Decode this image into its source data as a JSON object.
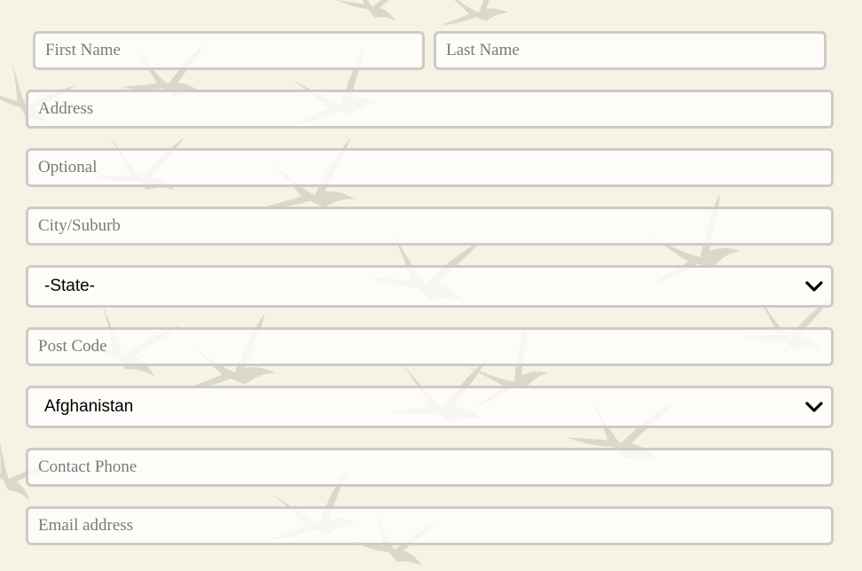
{
  "form": {
    "first_name": {
      "placeholder": "First Name",
      "value": ""
    },
    "last_name": {
      "placeholder": "Last Name",
      "value": ""
    },
    "address": {
      "placeholder": "Address",
      "value": ""
    },
    "address_optional": {
      "placeholder": "Optional",
      "value": ""
    },
    "city": {
      "placeholder": "City/Suburb",
      "value": ""
    },
    "state": {
      "selected": "-State-"
    },
    "post_code": {
      "placeholder": "Post Code",
      "value": ""
    },
    "country": {
      "selected": "Afghanistan"
    },
    "phone": {
      "placeholder": "Contact Phone",
      "value": ""
    },
    "email": {
      "placeholder": "Email address",
      "value": ""
    }
  },
  "icons": {
    "dropdown": "chevron-down-icon",
    "background": "flying-birds-pattern"
  },
  "colors": {
    "background": "#f6f2e4",
    "field_border": "#cdcbc8",
    "field_fill": "#fdfcf9",
    "placeholder_text": "#7a7a7a",
    "select_text": "#000000"
  }
}
